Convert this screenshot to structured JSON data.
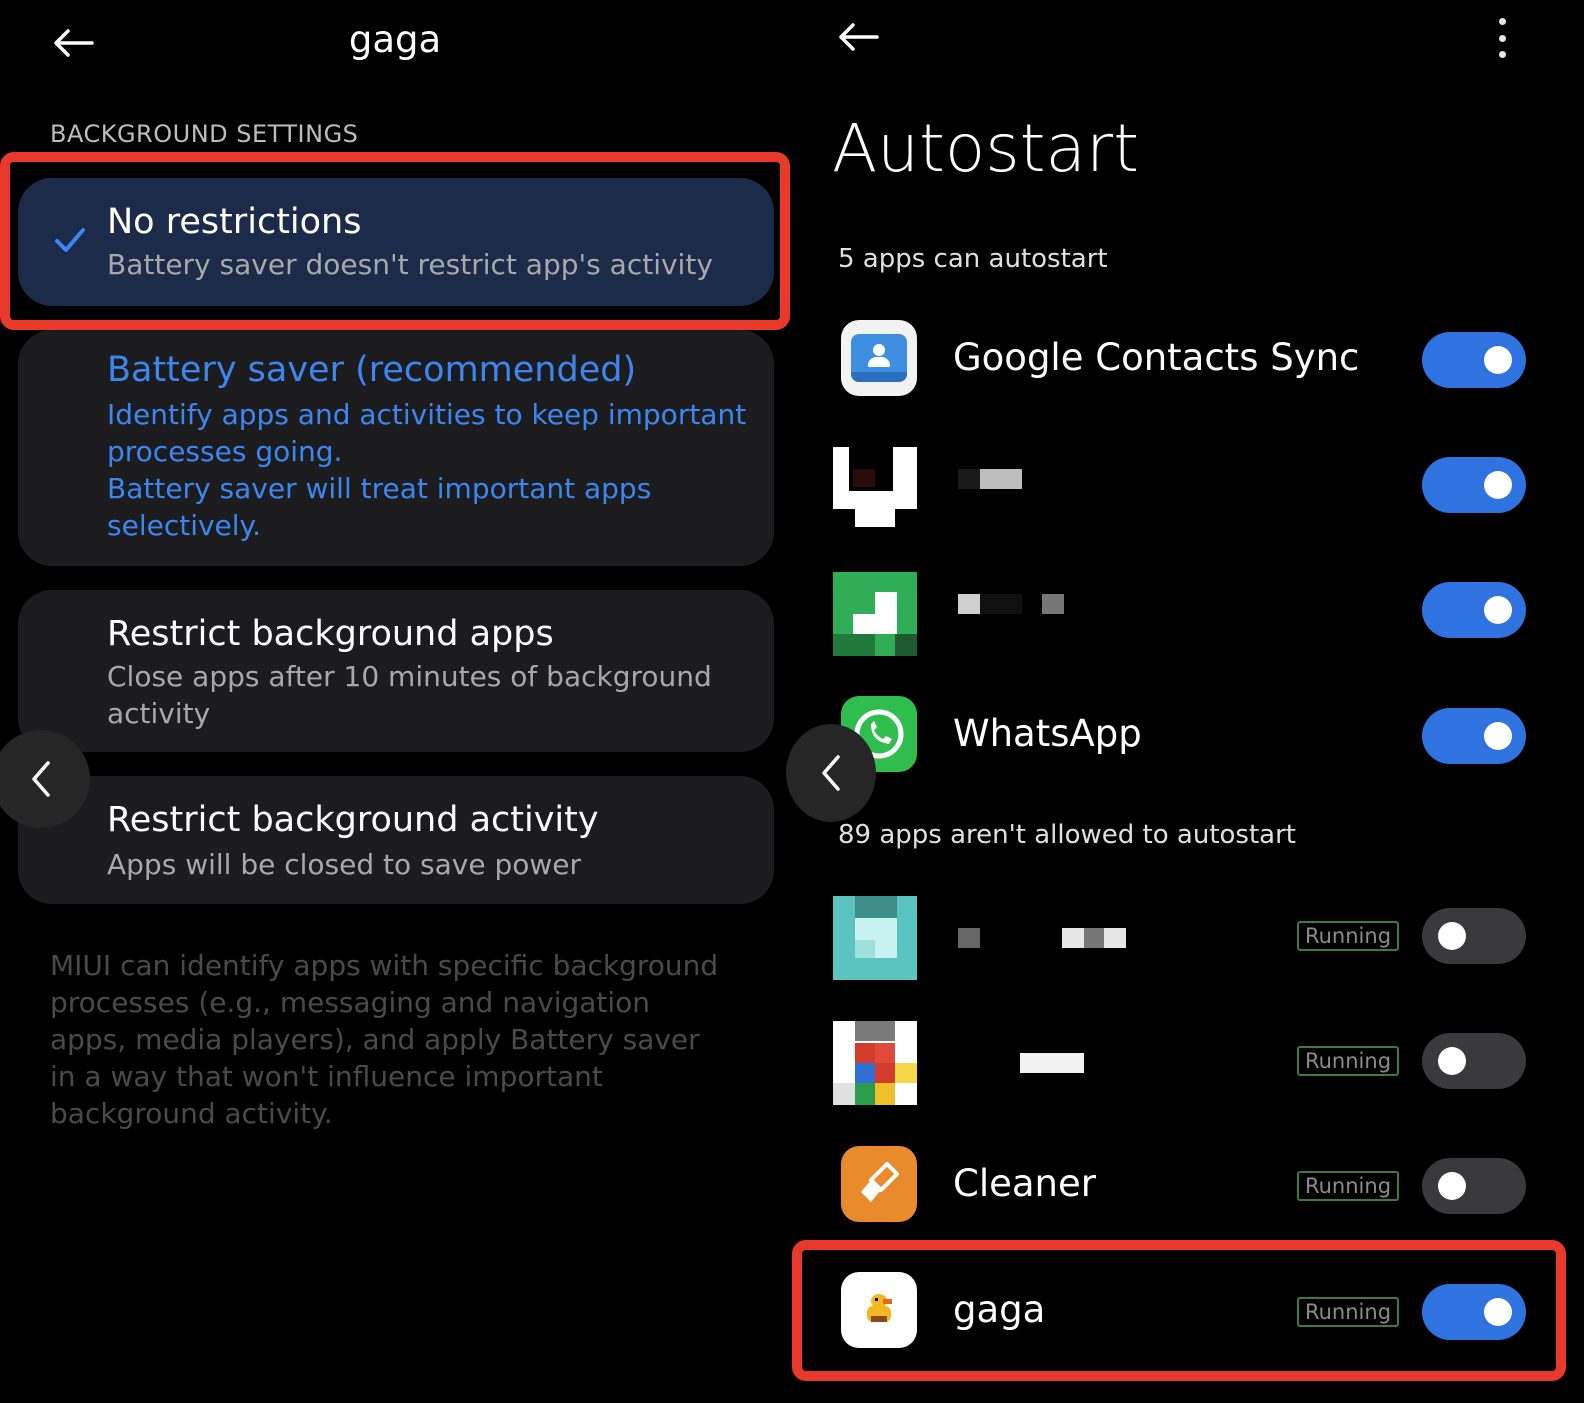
{
  "left_panel": {
    "title": "gaga",
    "section_label": "BACKGROUND SETTINGS",
    "options": [
      {
        "title": "No restrictions",
        "subtitle": "Battery saver doesn't restrict app's activity",
        "selected": true
      },
      {
        "title": "Battery saver (recommended)",
        "subtitle": "Identify apps and activities to keep important processes going.\nBattery saver will treat important apps selectively."
      },
      {
        "title": "Restrict background apps",
        "subtitle": "Close apps after 10 minutes of background activity"
      },
      {
        "title": "Restrict background activity",
        "subtitle": "Apps will be closed to save power"
      }
    ],
    "footnote": "MIUI can identify apps with specific background processes (e.g., messaging and navigation apps, media players), and apply Battery saver in a way that won't influence important background activity."
  },
  "right_panel": {
    "title": "Autostart",
    "allowed_label": "5 apps can autostart",
    "blocked_label": "89 apps aren't allowed to autostart",
    "allowed_apps": [
      {
        "name": "Google Contacts Sync",
        "enabled": true,
        "icon": "contacts-sync-icon"
      },
      {
        "name": "",
        "enabled": true,
        "icon": "pixelated-app-icon"
      },
      {
        "name": "",
        "enabled": true,
        "icon": "pixelated-app-icon"
      },
      {
        "name": "WhatsApp",
        "enabled": true,
        "icon": "whatsapp-icon"
      }
    ],
    "blocked_apps": [
      {
        "name": "",
        "status": "Running",
        "enabled": false,
        "icon": "pixelated-app-icon"
      },
      {
        "name": "",
        "status": "Running",
        "enabled": false,
        "icon": "pixelated-app-icon"
      },
      {
        "name": "Cleaner",
        "status": "Running",
        "enabled": false,
        "icon": "cleaner-icon"
      },
      {
        "name": "gaga",
        "status": "Running",
        "enabled": true,
        "icon": "gaga-duck-icon"
      }
    ]
  },
  "colors": {
    "accent_blue": "#2e73df",
    "recommended_text": "#3c86f1",
    "selected_card": "#1d2b4a",
    "highlight_red": "#e8392a"
  }
}
